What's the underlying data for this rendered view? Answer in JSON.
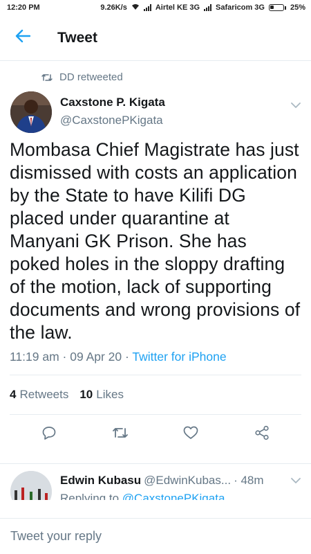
{
  "status_bar": {
    "time": "12:20 PM",
    "speed": "9.26K/s",
    "carrier1": "Airtel KE 3G",
    "carrier2": "Safaricom 3G",
    "battery": "25%"
  },
  "header": {
    "title": "Tweet",
    "back_icon": "arrow-left-icon",
    "accent": "#1da1f2"
  },
  "retweet": {
    "label": "DD retweeted",
    "icon": "retweet-icon"
  },
  "tweet": {
    "author_name": "Caxstone P. Kigata",
    "author_handle": "@CaxstonePKigata",
    "text": "Mombasa Chief Magistrate has just dismissed with costs an application by the State to have Kilifi DG placed under quarantine at Manyani GK Prison. She has poked holes in the sloppy drafting of the motion, lack of supporting documents and wrong provisions of the law.",
    "timestamp": "11:19 am · 09 Apr 20 · ",
    "source": "Twitter for iPhone",
    "retweets_count": "4",
    "retweets_label": "Retweets",
    "likes_count": "10",
    "likes_label": "Likes"
  },
  "actions": {
    "reply_icon": "reply-icon",
    "retweet_icon": "retweet-icon",
    "like_icon": "heart-icon",
    "share_icon": "share-icon"
  },
  "reply_preview": {
    "name": "Edwin Kubasu",
    "handle": "@EdwinKubas...",
    "time": "· 48m",
    "replying_prefix": "Replying to ",
    "replying_mention": "@CaxstonePKigata"
  },
  "composer": {
    "placeholder": "Tweet your reply"
  },
  "colors": {
    "text": "#14171a",
    "muted": "#657786",
    "link": "#1da1f2",
    "border": "#e6ecf0"
  }
}
